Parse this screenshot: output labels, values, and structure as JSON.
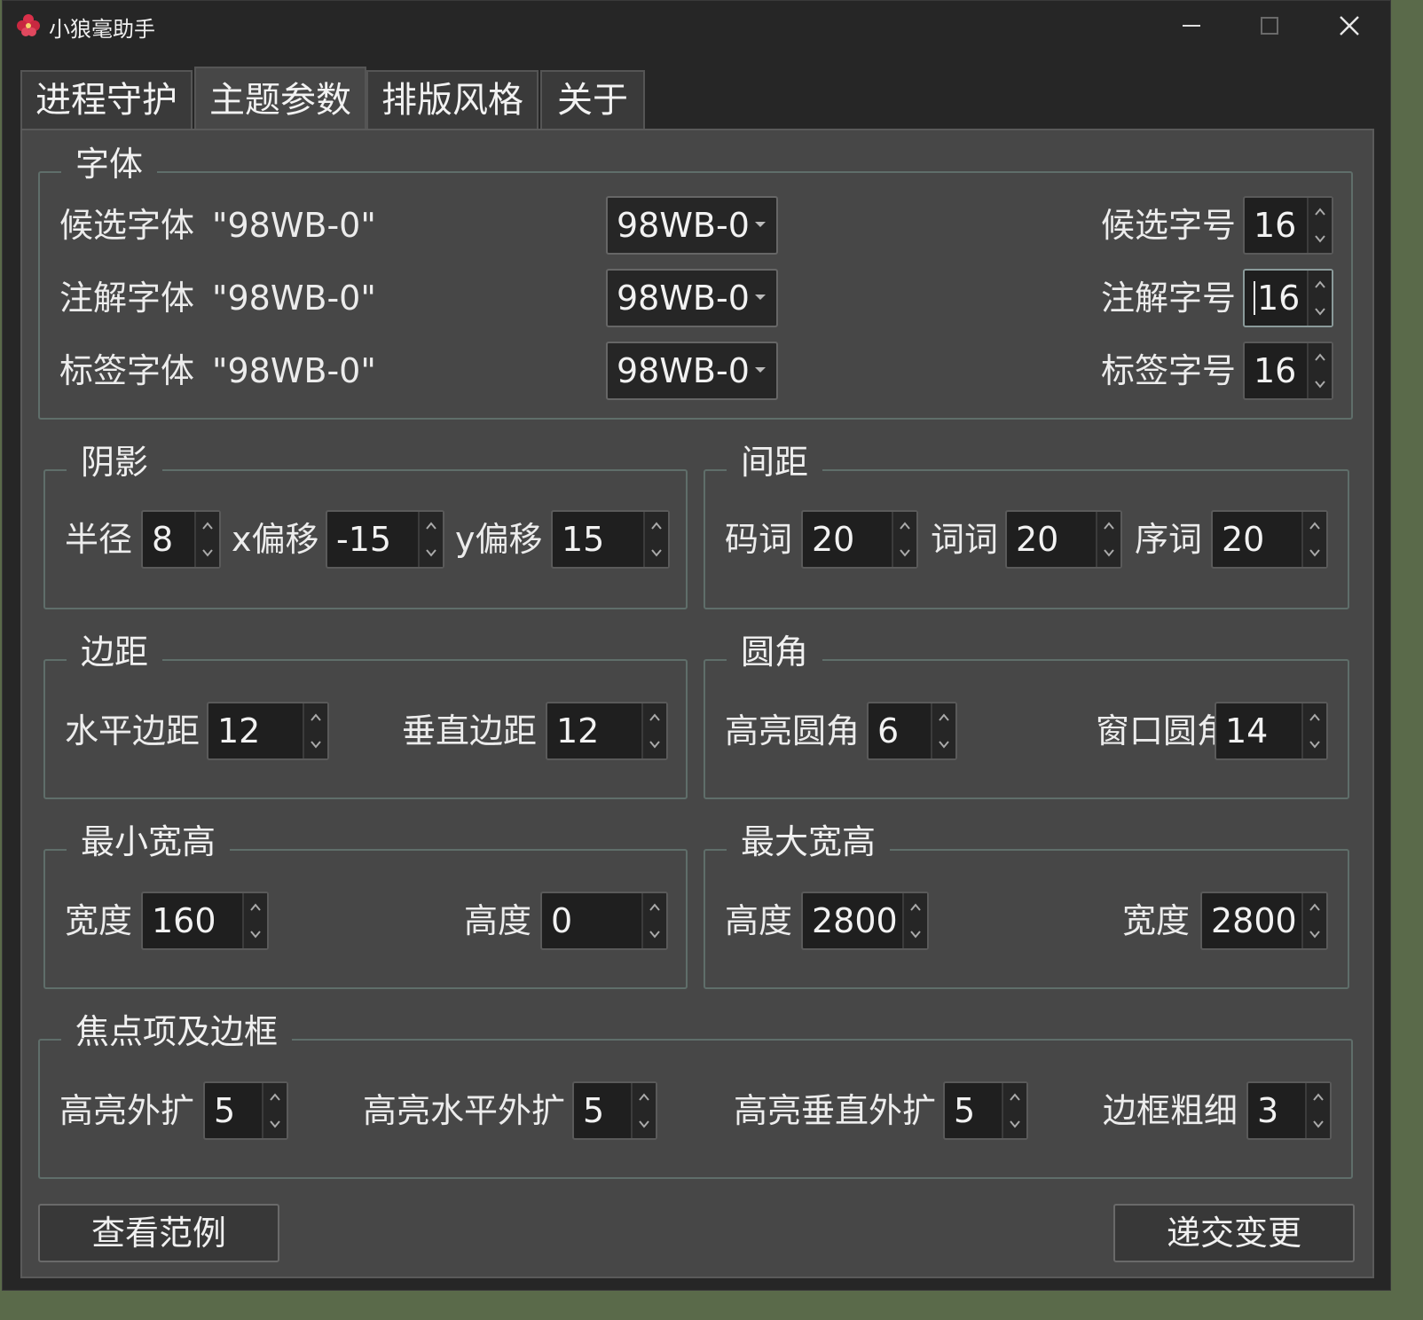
{
  "window": {
    "title": "小狼毫助手"
  },
  "tabs": [
    {
      "label": "进程守护"
    },
    {
      "label": "主题参数"
    },
    {
      "label": "排版风格"
    },
    {
      "label": "关于"
    }
  ],
  "font": {
    "title": "字体",
    "rows": [
      {
        "label": "候选字体",
        "current": "\"98WB-0\"",
        "combo": "98WB-0",
        "size_label": "候选字号",
        "size": "16"
      },
      {
        "label": "注解字体",
        "current": "\"98WB-0\"",
        "combo": "98WB-0",
        "size_label": "注解字号",
        "size": "16"
      },
      {
        "label": "标签字体",
        "current": "\"98WB-0\"",
        "combo": "98WB-0",
        "size_label": "标签字号",
        "size": "16"
      }
    ]
  },
  "shadow": {
    "title": "阴影",
    "radius_label": "半径",
    "radius": "8",
    "x_label": "x偏移",
    "x": "-15",
    "y_label": "y偏移",
    "y": "15"
  },
  "spacing": {
    "title": "间距",
    "a_label": "码词",
    "a": "20",
    "b_label": "词词",
    "b": "20",
    "c_label": "序词",
    "c": "20"
  },
  "margin": {
    "title": "边距",
    "h_label": "水平边距",
    "h": "12",
    "v_label": "垂直边距",
    "v": "12"
  },
  "corner": {
    "title": "圆角",
    "hl_label": "高亮圆角",
    "hl": "6",
    "win_label": "窗口圆角",
    "win": "14"
  },
  "min_size": {
    "title": "最小宽高",
    "w_label": "宽度",
    "w": "160",
    "h_label": "高度",
    "h": "0"
  },
  "max_size": {
    "title": "最大宽高",
    "h_label": "高度",
    "h": "2800",
    "w_label": "宽度",
    "w": "2800"
  },
  "focus": {
    "title": "焦点项及边框",
    "a_label": "高亮外扩",
    "a": "5",
    "b_label": "高亮水平外扩",
    "b": "5",
    "c_label": "高亮垂直外扩",
    "c": "5",
    "d_label": "边框粗细",
    "d": "3"
  },
  "buttons": {
    "preview": "查看范例",
    "submit": "递交变更"
  }
}
